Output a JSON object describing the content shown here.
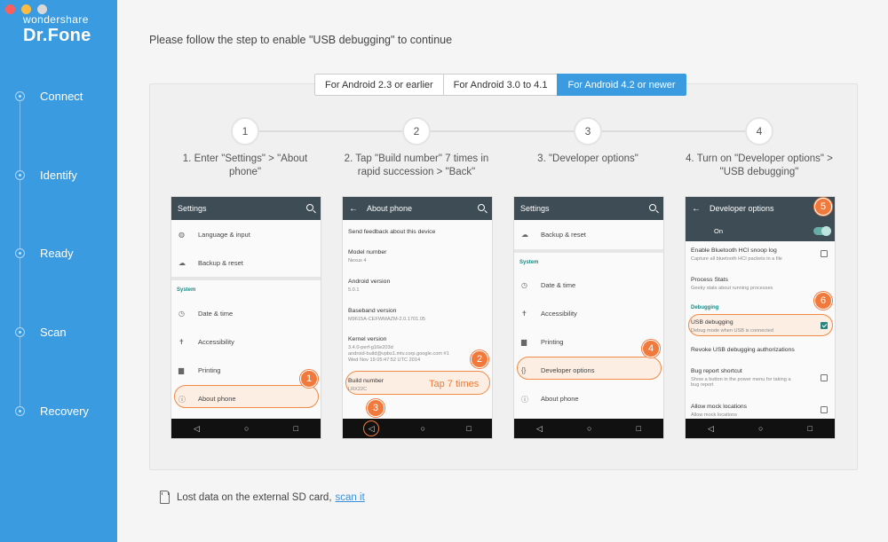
{
  "sidebar": {
    "brand": "wondershare",
    "product": "Dr.Fone",
    "items": [
      {
        "label": "Connect"
      },
      {
        "label": "Identify"
      },
      {
        "label": "Ready"
      },
      {
        "label": "Scan"
      },
      {
        "label": "Recovery"
      }
    ]
  },
  "main": {
    "instruction": "Please follow the step to enable \"USB debugging\" to continue",
    "tabs": [
      {
        "label": "For Android 2.3 or earlier",
        "active": false
      },
      {
        "label": "For Android 3.0 to 4.1",
        "active": false
      },
      {
        "label": "For Android 4.2 or newer",
        "active": true
      }
    ],
    "steps": [
      {
        "number": "1",
        "text": "1. Enter \"Settings\" > \"About phone\""
      },
      {
        "number": "2",
        "text": "2. Tap \"Build number\" 7 times in rapid succession > \"Back\""
      },
      {
        "number": "3",
        "text": "3. \"Developer options\""
      },
      {
        "number": "4",
        "text": "4. Turn on \"Developer options\" > \"USB debugging\""
      }
    ],
    "phone1": {
      "title": "Settings",
      "items": [
        "Language & input",
        "Backup & reset",
        "Date & time",
        "Accessibility",
        "Printing",
        "About phone"
      ],
      "section": "System",
      "badge": "1"
    },
    "phone2": {
      "title": "About phone",
      "feedback": "Send feedback about this device",
      "rows": [
        {
          "label": "Model number",
          "value": "Nexus 4"
        },
        {
          "label": "Android version",
          "value": "5.0.1"
        },
        {
          "label": "Baseband version",
          "value": "M9615A-CEFWMAZM-2.0.1701.05"
        },
        {
          "label": "Kernel version",
          "value": "3.4.0-perf-g16e203d",
          "value2": "android-build@vpbs1.mtv.corp.google.com #1",
          "value3": "Wed Nov 19 05:47:52 UTC 2014"
        },
        {
          "label": "Build number",
          "value": "LRX22C"
        }
      ],
      "tap_text": "Tap 7 times",
      "badge_tap": "2",
      "badge_back": "3"
    },
    "phone3": {
      "title": "Settings",
      "items": [
        "Backup & reset",
        "Date & time",
        "Accessibility",
        "Printing",
        "Developer options",
        "About phone"
      ],
      "section": "System",
      "badge": "4"
    },
    "phone4": {
      "title": "Developer options",
      "on_label": "On",
      "rows": [
        {
          "label": "Enable Bluetooth HCI snoop log",
          "sub": "Capture all bluetooth HCI packets in a file"
        },
        {
          "label": "Process Stats",
          "sub": "Geeky stats about running processes"
        },
        {
          "label": "USB debugging",
          "sub": "Debug mode when USB is connected"
        },
        {
          "label": "Revoke USB debugging authorizations"
        },
        {
          "label": "Bug report shortcut",
          "sub": "Show a button in the power menu for taking a",
          "sub2": "bug report"
        },
        {
          "label": "Allow mock locations",
          "sub": "Allow mock locations"
        }
      ],
      "section": "Debugging",
      "badge_toggle": "5",
      "badge_usb": "6"
    },
    "sd_text": "Lost data on the external SD card,",
    "sd_link": "scan it"
  }
}
